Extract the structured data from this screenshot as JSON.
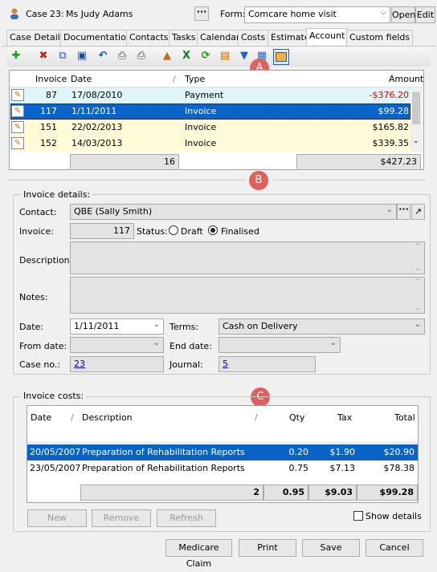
{
  "header": {
    "case_label": "Case",
    "case_number": "23:",
    "case_name": "Ms Judy Adams",
    "form_label": "Form:",
    "form_value": "Comcare home visit",
    "open": "Open",
    "edit": "Edit"
  },
  "tabs": [
    "Case Details",
    "Documentation",
    "Contacts",
    "Tasks",
    "Calendar",
    "Costs",
    "Estimate",
    "Account",
    "Custom fields"
  ],
  "active_tab": "Account",
  "ledger": {
    "headers": {
      "invoice": "Invoice",
      "date": "Date",
      "type": "Type",
      "amount": "Amount"
    },
    "rows": [
      {
        "invoice": "87",
        "date": "17/08/2010",
        "type": "Payment",
        "amount": "-$376.20"
      },
      {
        "invoice": "117",
        "date": "1/11/2011",
        "type": "Invoice",
        "amount": "$99.28"
      },
      {
        "invoice": "151",
        "date": "22/02/2013",
        "type": "Invoice",
        "amount": "$165.82"
      },
      {
        "invoice": "152",
        "date": "14/03/2013",
        "type": "Invoice",
        "amount": "$339.35"
      }
    ],
    "total_count": "16",
    "total_amount": "$427.23"
  },
  "details": {
    "legend": "Invoice details:",
    "contact_label": "Contact:",
    "contact_value": "QBE (Sally Smith)",
    "invoice_label": "Invoice:",
    "invoice_value": "117",
    "status_label": "Status:",
    "draft": "Draft",
    "finalised": "Finalised",
    "description_label": "Description:",
    "notes_label": "Notes:",
    "date_label": "Date:",
    "date_value": "1/11/2011",
    "terms_label": "Terms:",
    "terms_value": "Cash on Delivery",
    "from_label": "From date:",
    "end_label": "End date:",
    "case_label": "Case no.:",
    "case_value": "23",
    "journal_label": "Journal:",
    "journal_value": "5"
  },
  "costs": {
    "legend": "Invoice costs:",
    "headers": {
      "date": "Date",
      "description": "Description",
      "qty": "Qty",
      "tax": "Tax",
      "total": "Total"
    },
    "rows": [
      {
        "date": "20/05/2007",
        "description": "Preparation of Rehabilitation Reports",
        "qty": "0.20",
        "tax": "$1.90",
        "total": "$20.90"
      },
      {
        "date": "23/05/2007",
        "description": "Preparation of Rehabilitation Reports",
        "qty": "0.75",
        "tax": "$7.13",
        "total": "$78.38"
      }
    ],
    "totals": {
      "count": "2",
      "qty": "0.95",
      "tax": "$9.03",
      "total": "$99.28"
    },
    "new": "New",
    "remove": "Remove",
    "refresh": "Refresh",
    "show_details": "Show details"
  },
  "footer": {
    "medicare": "Medicare Claim",
    "print": "Print",
    "save": "Save",
    "cancel": "Cancel"
  },
  "badges": {
    "a": "A",
    "b": "B",
    "c": "C"
  },
  "colors": {
    "selection": "#0a64c8",
    "payment_row": "#e0f6f6",
    "invoice_row": "#fffbd8",
    "negative": "#e00000",
    "badge": "#e06060"
  }
}
